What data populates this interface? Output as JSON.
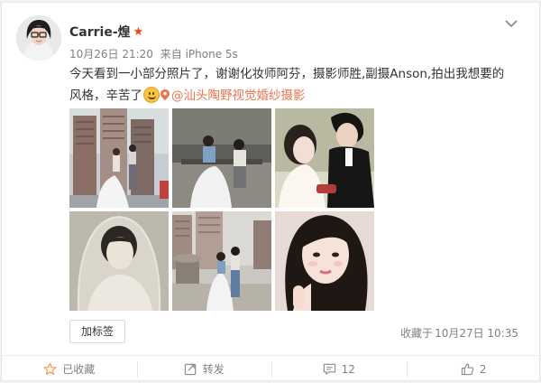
{
  "post": {
    "author": "Carrie-煌",
    "verified_badge_icon": "star-badge-icon",
    "date": "10月26日 21:20",
    "source": "来自 iPhone 5s",
    "text_line1": "今天看到一小部分照片了，谢谢化妆师阿芬，摄影师胜,副摄Anson,拍出我想要的",
    "text_line2": "风格，辛苦了",
    "emoji_icon": "smiley-face-icon",
    "mention": "@汕头陶野视觉婚纱摄影",
    "photo_count": 6
  },
  "footer": {
    "tag_button_label": "加标签",
    "favorited_label": "收藏于",
    "favorited_time": "10月27日 10:35"
  },
  "actions": [
    {
      "icon": "star-outline-icon",
      "label": "已收藏"
    },
    {
      "icon": "repost-icon",
      "label": "转发"
    },
    {
      "icon": "comment-icon",
      "label": "12"
    },
    {
      "icon": "thumbs-up-icon",
      "label": "2"
    }
  ],
  "colors": {
    "accent_orange": "#eb7350",
    "badge_red": "#e8451e",
    "muted_text": "#808080",
    "favorited_star": "#f59c51"
  }
}
